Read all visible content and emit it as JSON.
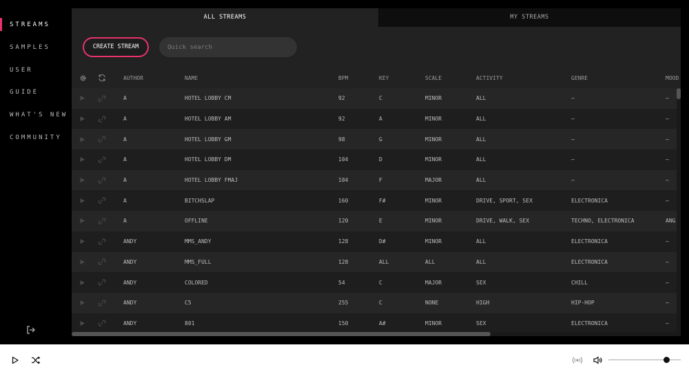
{
  "sidebar": {
    "items": [
      {
        "label": "STREAMS",
        "active": true
      },
      {
        "label": "SAMPLES",
        "active": false
      },
      {
        "label": "USER",
        "active": false
      },
      {
        "label": "GUIDE",
        "active": false
      },
      {
        "label": "WHAT'S NEW",
        "active": false
      },
      {
        "label": "COMMUNITY",
        "active": false
      }
    ],
    "logout_icon": "logout-icon"
  },
  "tabs": [
    {
      "label": "ALL STREAMS",
      "active": true
    },
    {
      "label": "MY STREAMS",
      "active": false
    }
  ],
  "toolbar": {
    "create_label": "CREATE STREAM",
    "search_placeholder": "Quick search",
    "search_value": ""
  },
  "table": {
    "headers": {
      "settings_icon": "gear-icon",
      "refresh_icon": "refresh-icon",
      "author": "AUTHOR",
      "name": "NAME",
      "bpm": "BPM",
      "key": "KEY",
      "scale": "SCALE",
      "activity": "ACTIVITY",
      "genre": "GENRE",
      "mood": "MOOD"
    },
    "rows": [
      {
        "author": "A",
        "name": "HOTEL LOBBY CM",
        "bpm": "92",
        "key": "C",
        "scale": "MINOR",
        "activity": "ALL",
        "genre": "—",
        "mood": "—"
      },
      {
        "author": "A",
        "name": "HOTEL LOBBY AM",
        "bpm": "92",
        "key": "A",
        "scale": "MINOR",
        "activity": "ALL",
        "genre": "—",
        "mood": "—"
      },
      {
        "author": "A",
        "name": "HOTEL LOBBY GM",
        "bpm": "98",
        "key": "G",
        "scale": "MINOR",
        "activity": "ALL",
        "genre": "—",
        "mood": "—"
      },
      {
        "author": "A",
        "name": "HOTEL LOBBY DM",
        "bpm": "104",
        "key": "D",
        "scale": "MINOR",
        "activity": "ALL",
        "genre": "—",
        "mood": "—"
      },
      {
        "author": "A",
        "name": "HOTEL LOBBY FMAJ",
        "bpm": "104",
        "key": "F",
        "scale": "MAJOR",
        "activity": "ALL",
        "genre": "—",
        "mood": "—"
      },
      {
        "author": "A",
        "name": "BITCHSLAP",
        "bpm": "160",
        "key": "F#",
        "scale": "MINOR",
        "activity": "DRIVE, SPORT, SEX",
        "genre": "ELECTRONICA",
        "mood": "—"
      },
      {
        "author": "A",
        "name": "OFFLINE",
        "bpm": "120",
        "key": "E",
        "scale": "MINOR",
        "activity": "DRIVE, WALK, SEX",
        "genre": "TECHNO, ELECTRONICA",
        "mood": "ANG"
      },
      {
        "author": "ANDY",
        "name": "MMS_ANDY",
        "bpm": "128",
        "key": "D#",
        "scale": "MINOR",
        "activity": "ALL",
        "genre": "ELECTRONICA",
        "mood": "—"
      },
      {
        "author": "ANDY",
        "name": "MMS_FULL",
        "bpm": "128",
        "key": "ALL",
        "scale": "ALL",
        "activity": "ALL",
        "genre": "ELECTRONICA",
        "mood": "—"
      },
      {
        "author": "ANDY",
        "name": "COLORED",
        "bpm": "54",
        "key": "C",
        "scale": "MAJOR",
        "activity": "SEX",
        "genre": "CHILL",
        "mood": "—"
      },
      {
        "author": "ANDY",
        "name": "C5",
        "bpm": "255",
        "key": "C",
        "scale": "NONE",
        "activity": "HIGH",
        "genre": "HIP-HOP",
        "mood": "—"
      },
      {
        "author": "ANDY",
        "name": "801",
        "bpm": "150",
        "key": "A#",
        "scale": "MINOR",
        "activity": "SEX",
        "genre": "ELECTRONICA",
        "mood": "—"
      }
    ]
  },
  "player": {
    "play_icon": "play-icon",
    "shuffle_icon": "shuffle-icon",
    "broadcast_icon": "broadcast-icon",
    "volume_icon": "volume-icon",
    "volume_level": 0.8
  },
  "colors": {
    "accent": "#e8336b",
    "panel": "#222222",
    "background": "#000000"
  }
}
